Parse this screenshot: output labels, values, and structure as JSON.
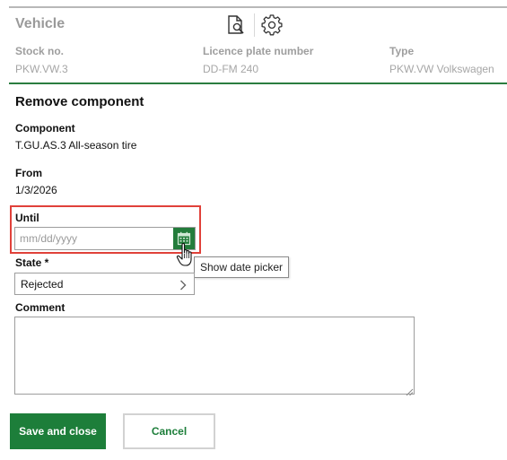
{
  "vehicle": {
    "title": "Vehicle",
    "fields": [
      {
        "label": "Stock no.",
        "value": "PKW.VW.3"
      },
      {
        "label": "Licence plate number",
        "value": "DD-FM 240"
      },
      {
        "label": "Type",
        "value": "PKW.VW Volkswagen"
      }
    ],
    "icons": [
      "document-search-icon",
      "gear-icon"
    ]
  },
  "form": {
    "title": "Remove component",
    "component": {
      "label": "Component",
      "value": "T.GU.AS.3 All-season tire"
    },
    "from": {
      "label": "From",
      "value": "1/3/2026"
    },
    "until": {
      "label": "Until",
      "placeholder": "mm/dd/yyyy",
      "value": ""
    },
    "date_picker_tooltip": "Show date picker",
    "state": {
      "label": "State *",
      "value": "Rejected"
    },
    "comment": {
      "label": "Comment",
      "value": ""
    }
  },
  "actions": {
    "save_label": "Save and close",
    "cancel_label": "Cancel"
  },
  "colors": {
    "accent": "#1d7e3a",
    "focus": "#e0413a",
    "muted": "#9e9e9e"
  }
}
